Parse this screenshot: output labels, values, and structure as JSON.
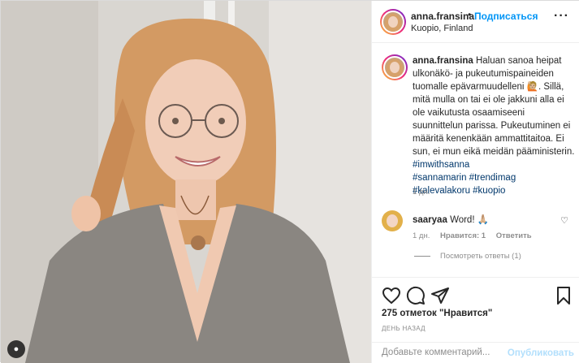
{
  "post": {
    "username": "anna.fransina",
    "follow_label": "Подписаться",
    "dot": "•",
    "location": "Kuopio, Finland",
    "more_icon": "more-horizontal-icon",
    "more_glyph": "···"
  },
  "caption": {
    "username": "anna.fransina",
    "text": "Haluan sanoa heipat ulkonäkö- ja pukeutumispaineiden tuomalle epävarmuudelleni 🙋🏼. Sillä, mitä mulla on tai ei ole jakkuni alla ei ole vaikutusta osaamiseeni suunnittelun parissa. Pukeutuminen ei määritä kenenkään ammattitaitoa. Ei sun, ei mun eikä meidän pääministerin.",
    "hashtags": [
      "#imwithsanna",
      "#sannamarin #trendimag",
      "#kalevalakoru #kuopio"
    ],
    "time": "1 дн."
  },
  "comment": {
    "username": "saaryaa",
    "text": "Word! 🙏🏼",
    "time": "1 дн.",
    "likes": "Нравится: 1",
    "reply": "Ответить",
    "heart_glyph": "♡",
    "view_replies": "Посмотреть ответы (1)"
  },
  "actions": {
    "likes_text": "275 отметок \"Нравится\"",
    "when": "ДЕНЬ НАЗАД",
    "icons": [
      "heart-icon",
      "comment-icon",
      "share-icon",
      "bookmark-icon"
    ]
  },
  "comment_box": {
    "placeholder": "Добавьте комментарий...",
    "publish_label": "Опубликовать"
  },
  "colors": {
    "link_blue": "#0095f6",
    "hashtag_blue": "#00376b",
    "muted": "#8e8e8e",
    "publish_disabled": "#b2dffc"
  }
}
